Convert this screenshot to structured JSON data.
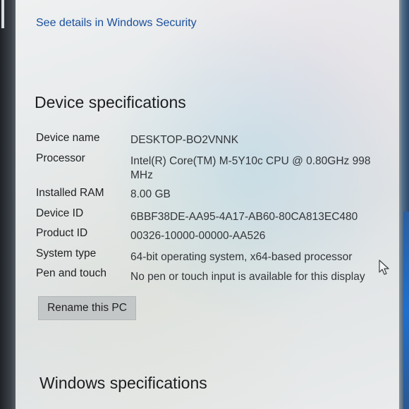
{
  "security_link": "See details in Windows Security",
  "device_specifications": {
    "title": "Device specifications",
    "rows": [
      {
        "label": "Device name",
        "value": "DESKTOP-BO2VNNK"
      },
      {
        "label": "Processor",
        "value": "Intel(R) Core(TM) M-5Y10c CPU @ 0.80GHz   998",
        "value_line2": "MHz"
      },
      {
        "label": "Installed RAM",
        "value": "8.00 GB"
      },
      {
        "label": "Device ID",
        "value": "6BBF38DE-AA95-4A17-AB60-80CA813EC480"
      },
      {
        "label": "Product ID",
        "value": "00326-10000-00000-AA526"
      },
      {
        "label": "System type",
        "value": "64-bit operating system, x64-based processor"
      },
      {
        "label": "Pen and touch",
        "value": "No pen or touch input is available for this display"
      }
    ],
    "rename_button": "Rename this PC"
  },
  "windows_specifications": {
    "title": "Windows specifications"
  },
  "icons": {
    "cursor": "mouse-pointer-icon"
  }
}
